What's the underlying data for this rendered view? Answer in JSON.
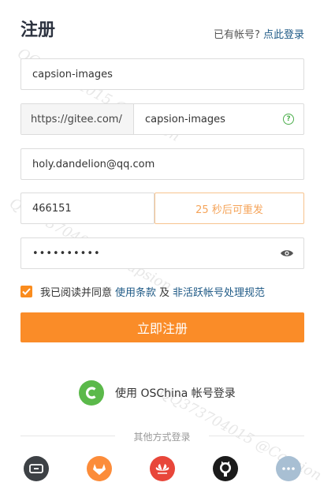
{
  "header": {
    "title": "注册",
    "has_account": "已有帐号?",
    "login_link": "点此登录"
  },
  "form": {
    "username_value": "capsion-images",
    "path_prefix": "https://gitee.com/",
    "path_value": "capsion-images",
    "path_help_icon": "question-icon",
    "email_value": "holy.dandelion@qq.com",
    "code_value": "466151",
    "resend_label": "25 秒后可重发",
    "password_value": "••••••••••",
    "password_toggle_icon": "eye-icon"
  },
  "agreement": {
    "checked": true,
    "prefix": "我已阅读并同意",
    "terms_link": "使用条款",
    "and": "及",
    "policy_link": "非活跃帐号处理规范"
  },
  "submit_label": "立即注册",
  "oschina_login": {
    "icon": "oschina-logo-icon",
    "label": "使用 OSChina 帐号登录"
  },
  "other_login": {
    "label": "其他方式登录",
    "providers": [
      "aliyun-icon",
      "gitlab-icon",
      "huawei-icon",
      "github-icon",
      "more-icon"
    ]
  },
  "colors": {
    "accent": "#fa8c28",
    "link": "#1f5a86",
    "success": "#4cae4c",
    "oschina": "#5bb94a"
  },
  "watermark": "QQ373704015 @Capsion"
}
